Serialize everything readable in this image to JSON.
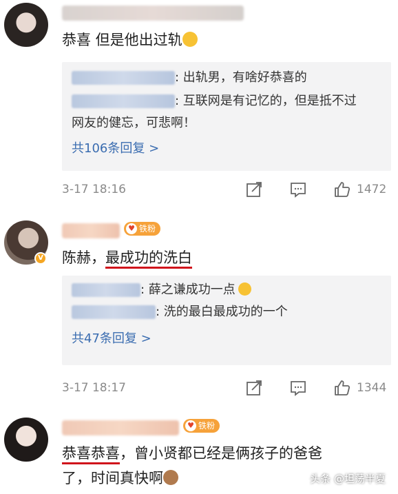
{
  "comments": [
    {
      "text": "恭喜  但是他出过轨",
      "emoji": "grin-emoji",
      "replies": [
        {
          "text": ": 出轨男，有啥好恭喜的"
        },
        {
          "text": ": 互联网是有记忆的，但是抵不过",
          "text2": "网友的健忘，可悲啊！"
        }
      ],
      "more_replies": "共106条回复 >",
      "time": "3-17 18:16",
      "likes": "1472"
    },
    {
      "text_a": "陈赫，",
      "text_b": "最成功的洗白",
      "badge": "铁粉",
      "replies": [
        {
          "text": ": 薛之谦成功一点"
        },
        {
          "text": ": 洗的最白最成功的一个"
        }
      ],
      "more_replies": "共47条回复 >",
      "time": "3-17 18:17",
      "likes": "1344"
    },
    {
      "text_a": "恭喜恭喜",
      "text_b": "，曾小贤都已经是俩孩子的爸爸",
      "text_c": "了，时间真快啊",
      "badge": "铁粉"
    }
  ],
  "watermark": "头条 @坦荡半夏",
  "colors": {
    "link": "#3a6cb0",
    "badge": "#f6a23a",
    "underline": "#d0121b"
  }
}
